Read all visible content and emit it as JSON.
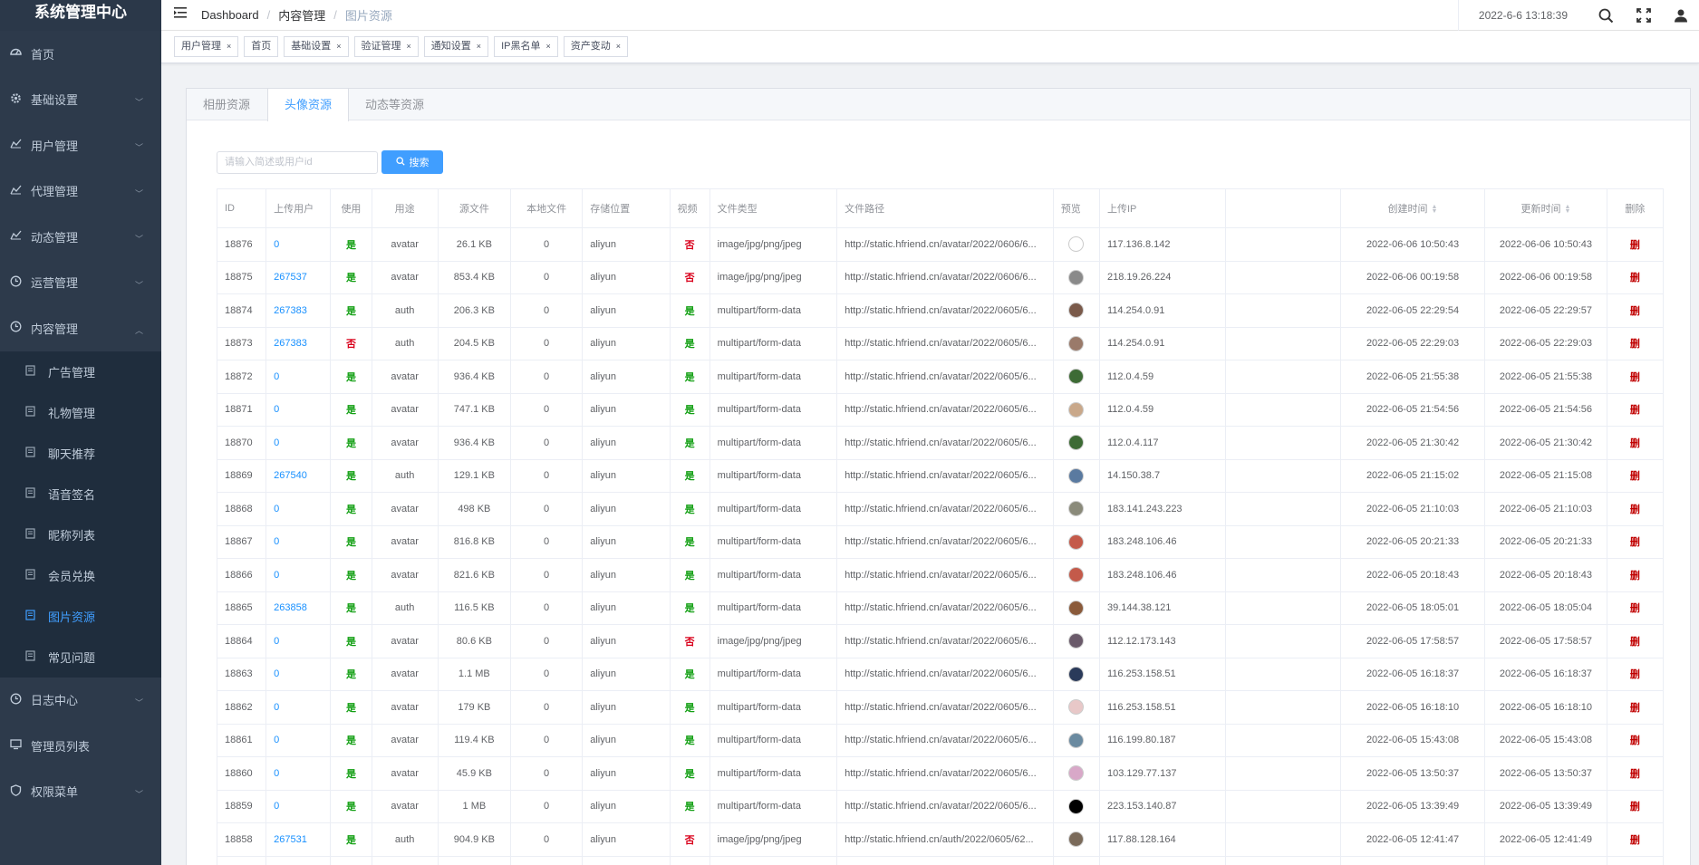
{
  "sidebar": {
    "title": "系统管理中心",
    "items": [
      {
        "label": "首页",
        "icon": "dashboard-icon",
        "has_children": false
      },
      {
        "label": "基础设置",
        "icon": "gear-icon",
        "has_children": true
      },
      {
        "label": "用户管理",
        "icon": "chart-icon",
        "has_children": true
      },
      {
        "label": "代理管理",
        "icon": "chart-icon",
        "has_children": true
      },
      {
        "label": "动态管理",
        "icon": "chart-icon",
        "has_children": true
      },
      {
        "label": "运营管理",
        "icon": "clock-icon",
        "has_children": true
      },
      {
        "label": "内容管理",
        "icon": "clock-icon",
        "has_children": true,
        "open": true
      },
      {
        "label": "日志中心",
        "icon": "clock-icon",
        "has_children": true
      },
      {
        "label": "管理员列表",
        "icon": "monitor-icon",
        "has_children": false
      },
      {
        "label": "权限菜单",
        "icon": "shield-icon",
        "has_children": true
      }
    ],
    "content_submenu": [
      {
        "label": "广告管理",
        "icon": "doc-icon"
      },
      {
        "label": "礼物管理",
        "icon": "doc-icon"
      },
      {
        "label": "聊天推荐",
        "icon": "doc-icon"
      },
      {
        "label": "语音签名",
        "icon": "doc-icon"
      },
      {
        "label": "昵称列表",
        "icon": "doc-icon"
      },
      {
        "label": "会员兑换",
        "icon": "doc-icon"
      },
      {
        "label": "图片资源",
        "icon": "doc-icon",
        "active": true
      },
      {
        "label": "常见问题",
        "icon": "doc-icon"
      }
    ]
  },
  "topbar": {
    "breadcrumb": [
      "Dashboard",
      "内容管理",
      "图片资源"
    ],
    "datetime": "2022-6-6 13:18:39"
  },
  "tags": [
    "用户管理",
    "首页",
    "基础设置",
    "验证管理",
    "通知设置",
    "IP黑名单",
    "资产变动"
  ],
  "tabs": [
    {
      "label": "相册资源",
      "active": false
    },
    {
      "label": "头像资源",
      "active": true
    },
    {
      "label": "动态等资源",
      "active": false
    }
  ],
  "search": {
    "placeholder": "请输入简述或用户id",
    "button_label": "搜索"
  },
  "table": {
    "headers": [
      "ID",
      "上传用户",
      "使用",
      "用途",
      "源文件",
      "本地文件",
      "存储位置",
      "视频",
      "文件类型",
      "文件路径",
      "预览",
      "上传IP",
      "",
      "创建时间",
      "更新时间",
      "删除"
    ],
    "delete_label": "删",
    "rows": [
      [
        "18876",
        "0",
        "是",
        "avatar",
        "26.1 KB",
        "0",
        "aliyun",
        "否",
        "image/jpg/png/jpeg",
        "http://static.hfriend.cn/avatar/2022/0606/6...",
        "117.136.8.142",
        "2022-06-06 10:50:43",
        "2022-06-06 10:50:43",
        "#ffffff"
      ],
      [
        "18875",
        "267537",
        "是",
        "avatar",
        "853.4 KB",
        "0",
        "aliyun",
        "否",
        "image/jpg/png/jpeg",
        "http://static.hfriend.cn/avatar/2022/0606/6...",
        "218.19.26.224",
        "2022-06-06 00:19:58",
        "2022-06-06 00:19:58",
        "#8a8a8a"
      ],
      [
        "18874",
        "267383",
        "是",
        "auth",
        "206.3 KB",
        "0",
        "aliyun",
        "是",
        "multipart/form-data",
        "http://static.hfriend.cn/avatar/2022/0605/6...",
        "114.254.0.91",
        "2022-06-05 22:29:54",
        "2022-06-05 22:29:57",
        "#7a5a4a"
      ],
      [
        "18873",
        "267383",
        "否",
        "auth",
        "204.5 KB",
        "0",
        "aliyun",
        "是",
        "multipart/form-data",
        "http://static.hfriend.cn/avatar/2022/0605/6...",
        "114.254.0.91",
        "2022-06-05 22:29:03",
        "2022-06-05 22:29:03",
        "#9a7a6a"
      ],
      [
        "18872",
        "0",
        "是",
        "avatar",
        "936.4 KB",
        "0",
        "aliyun",
        "是",
        "multipart/form-data",
        "http://static.hfriend.cn/avatar/2022/0605/6...",
        "112.0.4.59",
        "2022-06-05 21:55:38",
        "2022-06-05 21:55:38",
        "#3d6b35"
      ],
      [
        "18871",
        "0",
        "是",
        "avatar",
        "747.1 KB",
        "0",
        "aliyun",
        "是",
        "multipart/form-data",
        "http://static.hfriend.cn/avatar/2022/0605/6...",
        "112.0.4.59",
        "2022-06-05 21:54:56",
        "2022-06-05 21:54:56",
        "#c9a88a"
      ],
      [
        "18870",
        "0",
        "是",
        "avatar",
        "936.4 KB",
        "0",
        "aliyun",
        "是",
        "multipart/form-data",
        "http://static.hfriend.cn/avatar/2022/0605/6...",
        "112.0.4.117",
        "2022-06-05 21:30:42",
        "2022-06-05 21:30:42",
        "#3d6b35"
      ],
      [
        "18869",
        "267540",
        "是",
        "auth",
        "129.1 KB",
        "0",
        "aliyun",
        "是",
        "multipart/form-data",
        "http://static.hfriend.cn/avatar/2022/0605/6...",
        "14.150.38.7",
        "2022-06-05 21:15:02",
        "2022-06-05 21:15:08",
        "#5a7aa0"
      ],
      [
        "18868",
        "0",
        "是",
        "avatar",
        "498 KB",
        "0",
        "aliyun",
        "是",
        "multipart/form-data",
        "http://static.hfriend.cn/avatar/2022/0605/6...",
        "183.141.243.223",
        "2022-06-05 21:10:03",
        "2022-06-05 21:10:03",
        "#8a8a7a"
      ],
      [
        "18867",
        "0",
        "是",
        "avatar",
        "816.8 KB",
        "0",
        "aliyun",
        "是",
        "multipart/form-data",
        "http://static.hfriend.cn/avatar/2022/0605/6...",
        "183.248.106.46",
        "2022-06-05 20:21:33",
        "2022-06-05 20:21:33",
        "#c45a4a"
      ],
      [
        "18866",
        "0",
        "是",
        "avatar",
        "821.6 KB",
        "0",
        "aliyun",
        "是",
        "multipart/form-data",
        "http://static.hfriend.cn/avatar/2022/0605/6...",
        "183.248.106.46",
        "2022-06-05 20:18:43",
        "2022-06-05 20:18:43",
        "#c45a4a"
      ],
      [
        "18865",
        "263858",
        "是",
        "auth",
        "116.5 KB",
        "0",
        "aliyun",
        "是",
        "multipart/form-data",
        "http://static.hfriend.cn/avatar/2022/0605/6...",
        "39.144.38.121",
        "2022-06-05 18:05:01",
        "2022-06-05 18:05:04",
        "#8a5a3a"
      ],
      [
        "18864",
        "0",
        "是",
        "avatar",
        "80.6 KB",
        "0",
        "aliyun",
        "否",
        "image/jpg/png/jpeg",
        "http://static.hfriend.cn/avatar/2022/0605/6...",
        "112.12.173.143",
        "2022-06-05 17:58:57",
        "2022-06-05 17:58:57",
        "#6a5a6a"
      ],
      [
        "18863",
        "0",
        "是",
        "avatar",
        "1.1 MB",
        "0",
        "aliyun",
        "是",
        "multipart/form-data",
        "http://static.hfriend.cn/avatar/2022/0605/6...",
        "116.253.158.51",
        "2022-06-05 16:18:37",
        "2022-06-05 16:18:37",
        "#2a3a5a"
      ],
      [
        "18862",
        "0",
        "是",
        "avatar",
        "179 KB",
        "0",
        "aliyun",
        "是",
        "multipart/form-data",
        "http://static.hfriend.cn/avatar/2022/0605/6...",
        "116.253.158.51",
        "2022-06-05 16:18:10",
        "2022-06-05 16:18:10",
        "#e8c8c8"
      ],
      [
        "18861",
        "0",
        "是",
        "avatar",
        "119.4 KB",
        "0",
        "aliyun",
        "是",
        "multipart/form-data",
        "http://static.hfriend.cn/avatar/2022/0605/6...",
        "116.199.80.187",
        "2022-06-05 15:43:08",
        "2022-06-05 15:43:08",
        "#6a8aa0"
      ],
      [
        "18860",
        "0",
        "是",
        "avatar",
        "45.9 KB",
        "0",
        "aliyun",
        "是",
        "multipart/form-data",
        "http://static.hfriend.cn/avatar/2022/0605/6...",
        "103.129.77.137",
        "2022-06-05 13:50:37",
        "2022-06-05 13:50:37",
        "#d8a8c8"
      ],
      [
        "18859",
        "0",
        "是",
        "avatar",
        "1 MB",
        "0",
        "aliyun",
        "是",
        "multipart/form-data",
        "http://static.hfriend.cn/avatar/2022/0605/6...",
        "223.153.140.87",
        "2022-06-05 13:39:49",
        "2022-06-05 13:39:49",
        "#000000"
      ],
      [
        "18858",
        "267531",
        "是",
        "auth",
        "904.9 KB",
        "0",
        "aliyun",
        "否",
        "image/jpg/png/jpeg",
        "http://static.hfriend.cn/auth/2022/0605/62...",
        "117.88.128.164",
        "2022-06-05 12:41:47",
        "2022-06-05 12:41:49",
        "#7a6a5a"
      ],
      [
        "",
        "",
        "",
        "",
        "",
        "",
        "",
        "",
        "",
        "",
        "",
        "",
        "",
        "#a08a7a"
      ]
    ]
  }
}
